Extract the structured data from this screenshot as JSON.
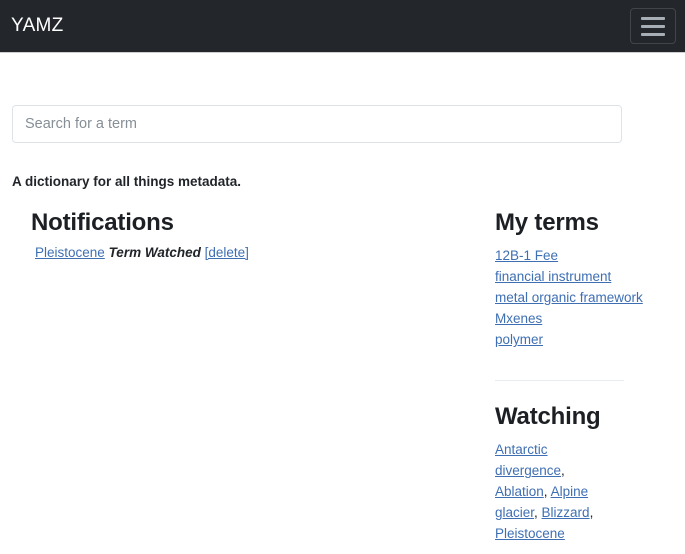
{
  "navbar": {
    "brand": "YAMZ",
    "toggle_label": "Toggle navigation"
  },
  "search": {
    "value": "",
    "placeholder": "Search for a term"
  },
  "tagline": "A dictionary for all things metadata.",
  "notifications": {
    "title": "Notifications",
    "items": [
      {
        "term": "Pleistocene",
        "action": "Term Watched",
        "delete_label": "[delete]"
      }
    ]
  },
  "my_terms": {
    "title": "My terms",
    "items": [
      "12B-1 Fee",
      "financial instrument",
      "metal organic framework",
      "Mxenes",
      "polymer"
    ]
  },
  "watching": {
    "title": "Watching",
    "items": [
      "Antarctic divergence",
      "Ablation",
      "Alpine glacier",
      "Blizzard",
      "Pleistocene"
    ],
    "separator": ", "
  },
  "colors": {
    "navbar_bg": "#23272b",
    "link": "#3f6fb3",
    "text": "#212529",
    "border": "#dfe3e6"
  }
}
